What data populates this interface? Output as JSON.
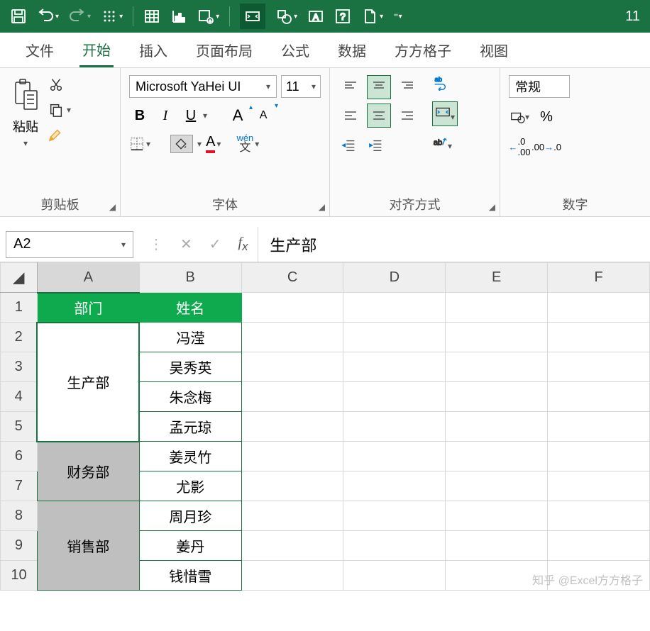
{
  "qat_number": "11",
  "tabs": [
    "文件",
    "开始",
    "插入",
    "页面布局",
    "公式",
    "数据",
    "方方格子",
    "视图"
  ],
  "active_tab": "开始",
  "clipboard": {
    "paste": "粘贴",
    "group": "剪贴板"
  },
  "font": {
    "name": "Microsoft YaHei UI",
    "size": "11",
    "group": "字体",
    "bold": "B",
    "italic": "I",
    "underline": "U",
    "bigA": "A",
    "smallA": "A",
    "fillA": "A",
    "fontA": "A",
    "phonetic_top": "wén",
    "phonetic_bottom": "文"
  },
  "align": {
    "group": "对齐方式",
    "wrap": "ab"
  },
  "number": {
    "group": "数字",
    "format": "常规",
    "pct": "%",
    "dec1": ".0",
    "dec2": ".00"
  },
  "namebox": "A2",
  "formula": "生产部",
  "columns": [
    "A",
    "B",
    "C",
    "D",
    "E",
    "F"
  ],
  "row_count": 10,
  "headers": {
    "dept": "部门",
    "name": "姓名"
  },
  "depts": [
    "生产部",
    "财务部",
    "销售部"
  ],
  "names": [
    "冯滢",
    "吴秀英",
    "朱念梅",
    "孟元琼",
    "姜灵竹",
    "尤影",
    "周月珍",
    "姜丹",
    "钱惜雪"
  ],
  "watermark": "知乎 @Excel方方格子"
}
